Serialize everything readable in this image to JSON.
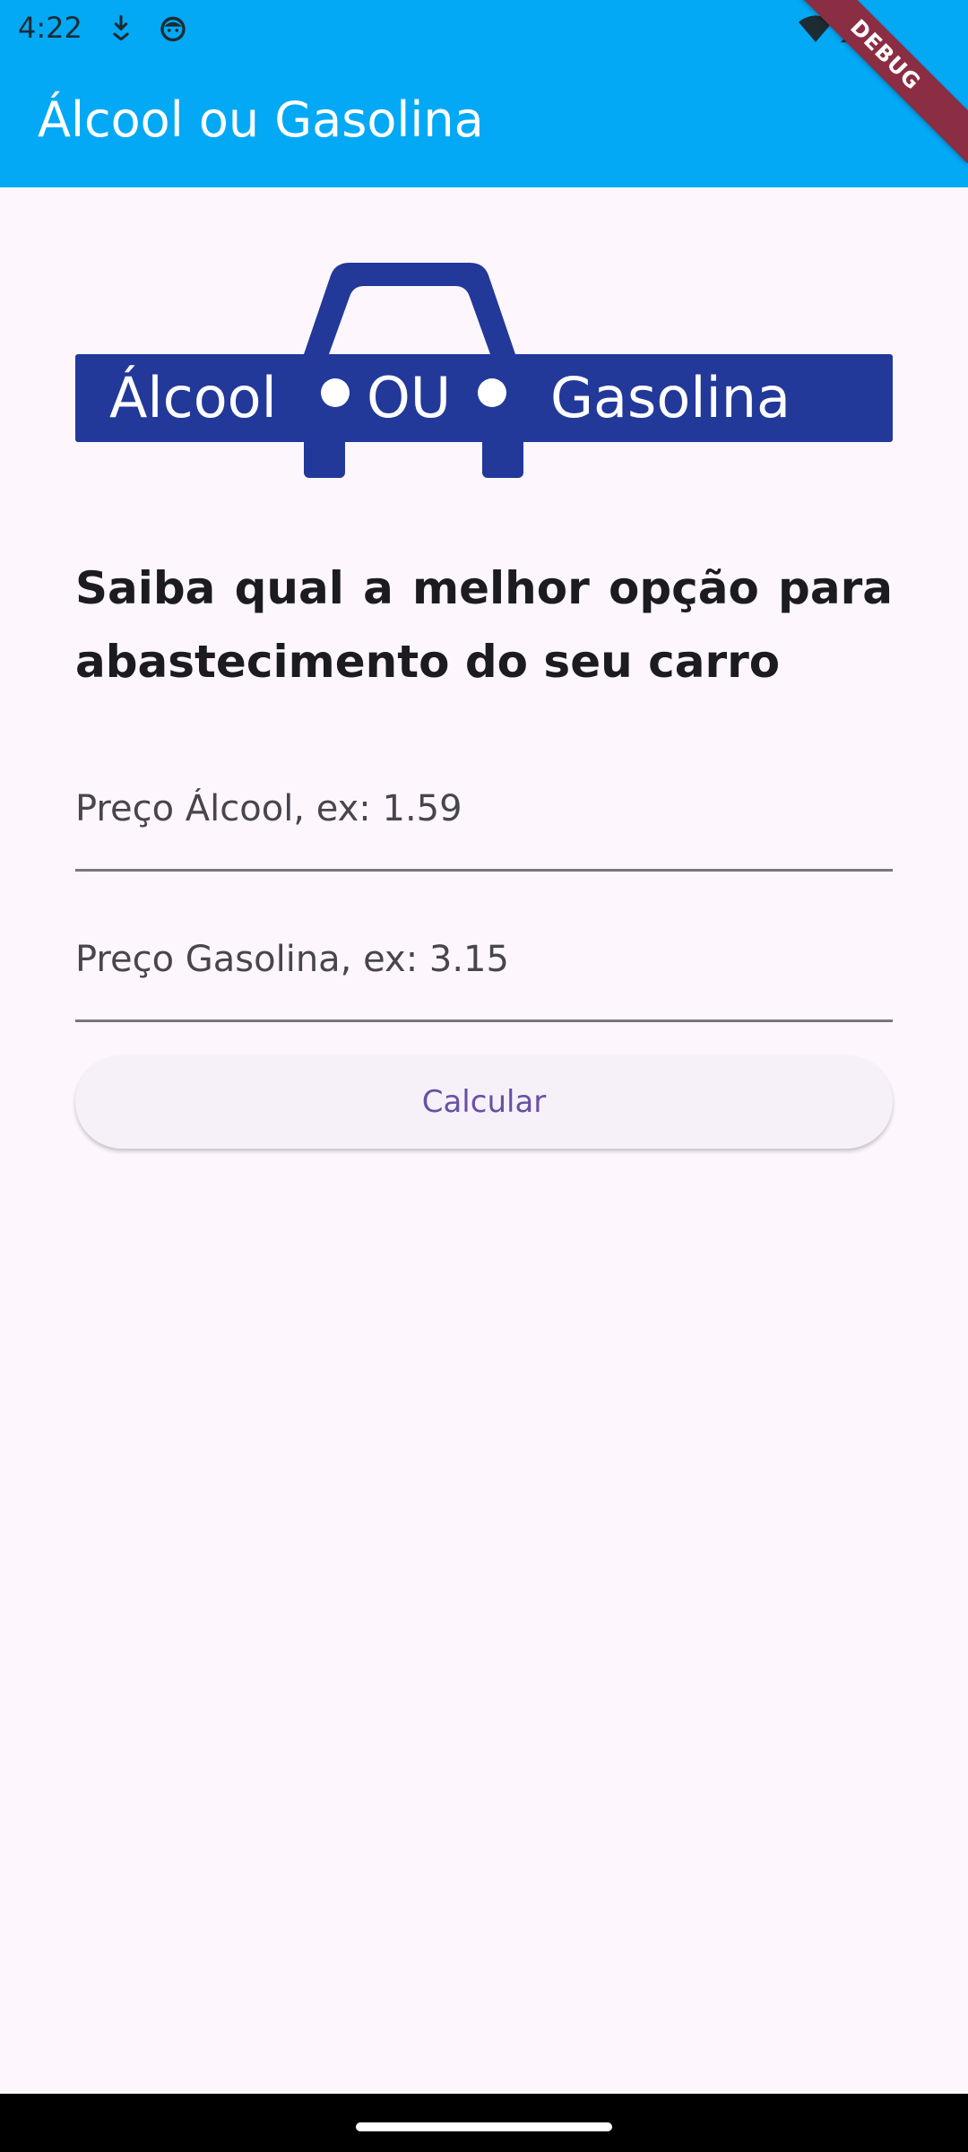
{
  "status_bar": {
    "time": "4:22",
    "icons": [
      "download-icon",
      "android-face-icon",
      "wifi-icon",
      "cellular-signal-icon"
    ]
  },
  "app_bar": {
    "title": "Álcool ou Gasolina",
    "color": "#03a9f4"
  },
  "debug_banner": {
    "label": "DEBUG",
    "color": "#8b2d43"
  },
  "logo": {
    "word_left": "Álcool",
    "word_mid": "OU",
    "word_right": "Gasolina",
    "color": "#22399a"
  },
  "headline": "Saiba qual a melhor opção para abastecimento do seu carro",
  "inputs": {
    "alcool": {
      "placeholder": "Preço Álcool, ex: 1.59",
      "value": ""
    },
    "gasolina": {
      "placeholder": "Preço Gasolina, ex: 3.15",
      "value": ""
    }
  },
  "button": {
    "label": "Calcular",
    "text_color": "#6750a4"
  }
}
